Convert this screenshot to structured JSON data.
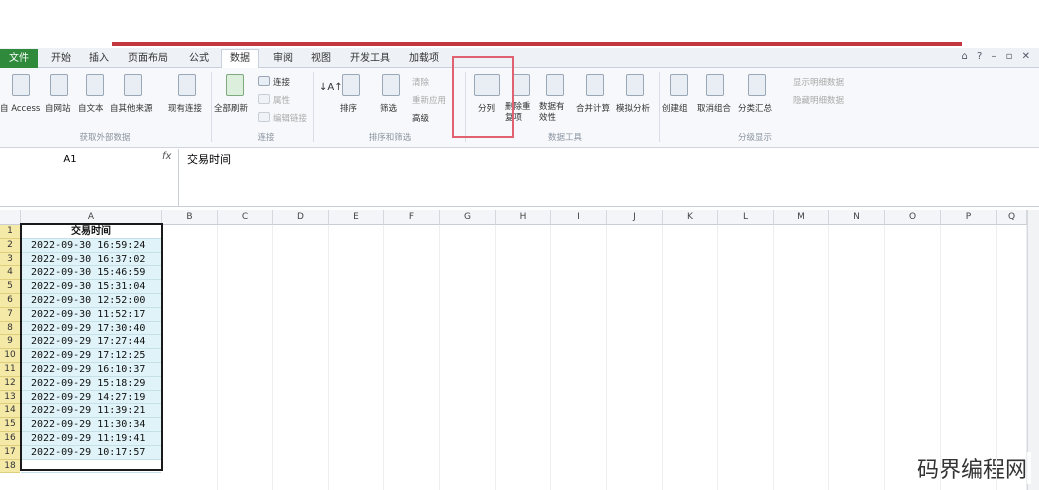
{
  "tabs": [
    "文件",
    "开始",
    "插入",
    "页面布局",
    "公式",
    "数据",
    "审阅",
    "视图",
    "开发工具",
    "加载项"
  ],
  "active_tab": "数据",
  "ribbon": {
    "ext_buttons": [
      "自 Access",
      "自网站",
      "自文本",
      "自其他来源",
      "现有连接"
    ],
    "refresh_all": "全部刷新",
    "conn_items": [
      "连接",
      "属性",
      "编辑链接"
    ],
    "sort_filter": [
      "排序",
      "筛选",
      "清除",
      "重新应用",
      "高级"
    ],
    "tools": [
      "分列",
      "删除重复项",
      "数据有效性",
      "合并计算",
      "模拟分析"
    ],
    "outline": [
      "创建组",
      "取消组合",
      "分类汇总",
      "显示明细数据",
      "隐藏明细数据"
    ],
    "groups": [
      "获取外部数据",
      "连接",
      "排序和筛选",
      "数据工具",
      "分级显示"
    ]
  },
  "formula_bar": {
    "name_box": "A1",
    "fx": "fx",
    "content": "交易时间"
  },
  "columns": [
    "A",
    "B",
    "C",
    "D",
    "E",
    "F",
    "G",
    "H",
    "I",
    "J",
    "K",
    "L",
    "M",
    "N",
    "O",
    "P",
    "Q"
  ],
  "rows": [
    "1",
    "2",
    "3",
    "4",
    "5",
    "6",
    "7",
    "8",
    "9",
    "10",
    "11",
    "12",
    "13",
    "14",
    "15",
    "16",
    "17",
    "18"
  ],
  "cells": [
    "交易时间",
    "2022-09-30 16:59:24",
    "2022-09-30 16:37:02",
    "2022-09-30 15:46:59",
    "2022-09-30 15:31:04",
    "2022-09-30 12:52:00",
    "2022-09-30 11:52:17",
    "2022-09-29 17:30:40",
    "2022-09-29 17:27:44",
    "2022-09-29 17:12:25",
    "2022-09-29 16:10:37",
    "2022-09-29 15:18:29",
    "2022-09-29 14:27:19",
    "2022-09-29 11:39:21",
    "2022-09-29 11:30:34",
    "2022-09-29 11:19:41",
    "2022-09-29 10:17:57",
    ""
  ],
  "watermark": "码界编程网"
}
